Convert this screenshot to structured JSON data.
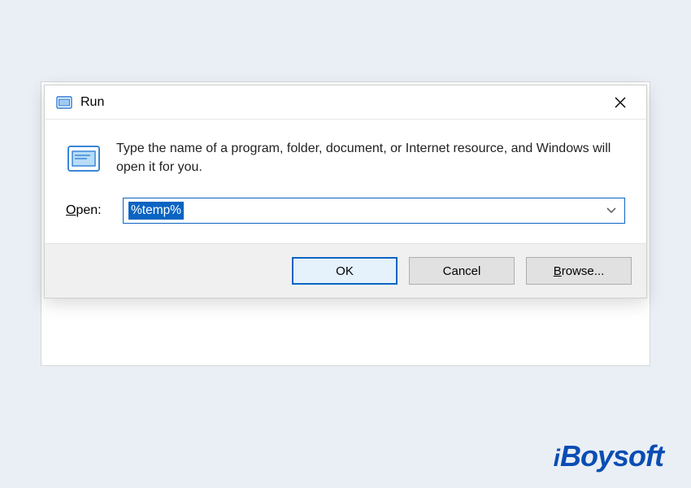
{
  "dialog": {
    "title": "Run",
    "description": "Type the name of a program, folder, document, or Internet resource, and Windows will open it for you.",
    "open_label_char": "O",
    "open_label_rest": "pen:",
    "input_value": "%temp%",
    "buttons": {
      "ok": "OK",
      "cancel": "Cancel",
      "browse_char": "B",
      "browse_rest": "rowse..."
    }
  },
  "watermark": "iBoysoft",
  "colors": {
    "accent": "#0a64c2",
    "brand": "#0a4db3"
  }
}
